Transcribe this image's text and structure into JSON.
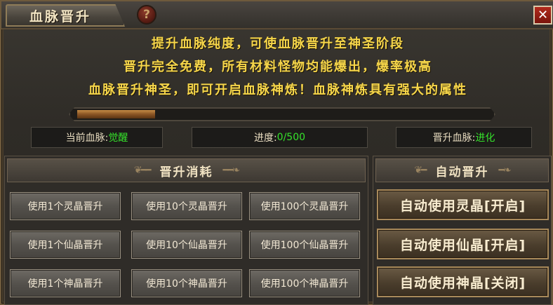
{
  "window": {
    "title": "血脉晋升",
    "help_glyph": "?",
    "close_glyph": "✕"
  },
  "description": [
    "提升血脉纯度，可使血脉晋升至神圣阶段",
    "晋升完全免费，所有材料怪物均能爆出，爆率极高",
    "血脉晋升神圣，即可开启血脉神炼！血脉神炼具有强大的属性"
  ],
  "progress": {
    "current": 0,
    "max": 500,
    "fill_fraction": 0.19,
    "label": "进度:",
    "value_text": "0/500"
  },
  "status": {
    "current_label": "当前血脉:",
    "current_value": "觉醒",
    "next_label": "晋升血脉:",
    "next_value": "进化"
  },
  "consume_panel": {
    "title": "晋升消耗",
    "buttons": [
      [
        "使用1个灵晶晋升",
        "使用10个灵晶晋升",
        "使用100个灵晶晋升"
      ],
      [
        "使用1个仙晶晋升",
        "使用10个仙晶晋升",
        "使用100个仙晶晋升"
      ],
      [
        "使用1个神晶晋升",
        "使用10个神晶晋升",
        "使用100个神晶晋升"
      ]
    ]
  },
  "auto_panel": {
    "title": "自动晋升",
    "buttons": [
      "自动使用灵晶[开启]",
      "自动使用仙晶[开启]",
      "自动使用神晶[关闭]"
    ]
  },
  "colors": {
    "gold_text": "#f6d64a",
    "green_value": "#35e22b",
    "close_red": "#b22a1c"
  }
}
